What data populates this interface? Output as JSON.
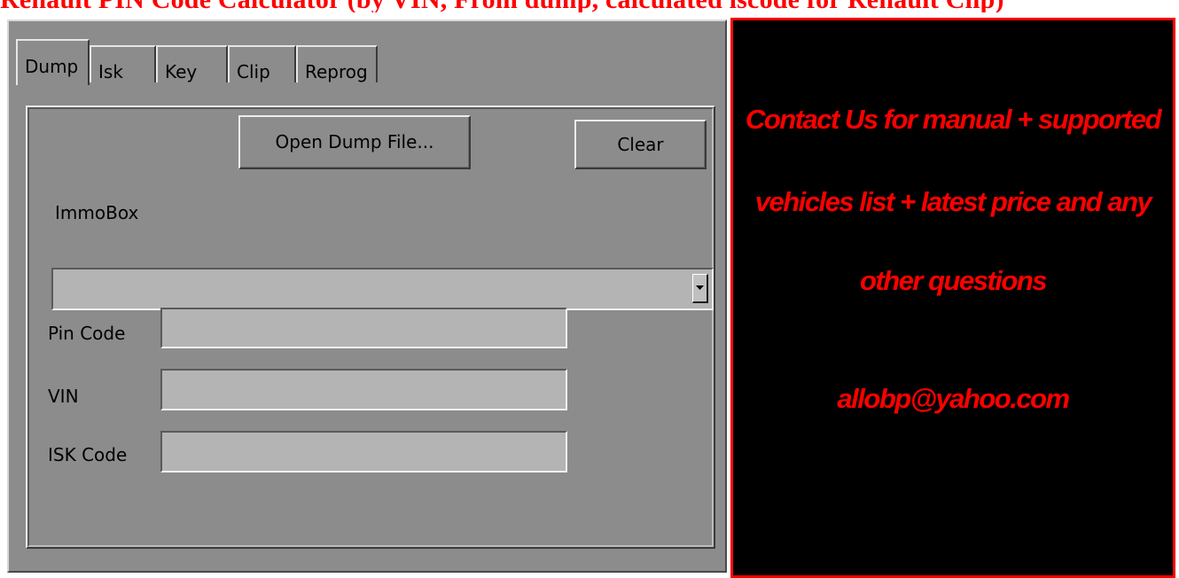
{
  "page_title": "Renault PIN Code Calculator (by VIN, From dump, calculated iscode for Renault Clip)",
  "tabs": [
    {
      "label": "Dump",
      "active": true
    },
    {
      "label": "Isk",
      "active": false
    },
    {
      "label": "Key",
      "active": false
    },
    {
      "label": "Clip",
      "active": false
    },
    {
      "label": "Reprog",
      "active": false
    }
  ],
  "dump_panel": {
    "open_button": "Open Dump File...",
    "clear_button": "Clear",
    "immobox_label": "ImmoBox",
    "immobox_value": "",
    "pin_code_label": "Pin Code",
    "pin_code_value": "",
    "vin_label": "VIN",
    "vin_value": "",
    "isk_code_label": "ISK Code",
    "isk_code_value": ""
  },
  "contact": {
    "line1": "Contact Us for manual + supported",
    "line2": "vehicles list + latest price and any",
    "line3": "other questions",
    "email": "allobp@yahoo.com"
  },
  "colors": {
    "window_bg": "#8c8c8c",
    "field_bg": "#b4b4b4",
    "accent_red": "#ff0000",
    "contact_bg": "#000000"
  }
}
